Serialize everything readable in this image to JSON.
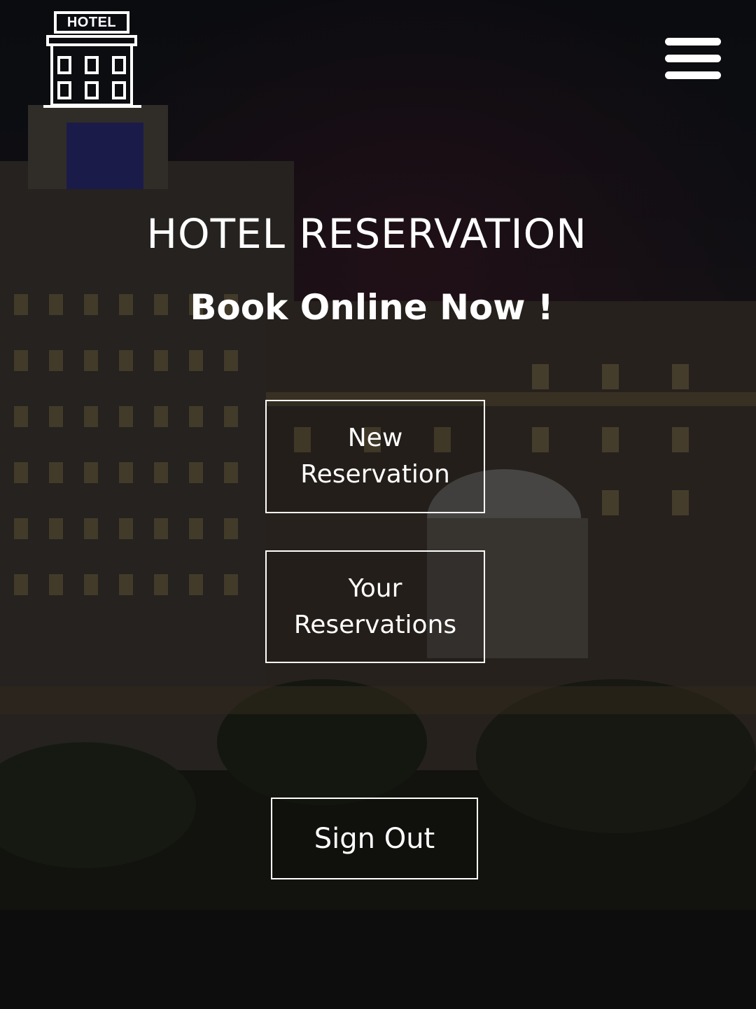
{
  "header": {
    "logo_text": "HOTEL",
    "logo_icon": "hotel-building-icon",
    "menu_icon": "hamburger-menu-icon"
  },
  "hero": {
    "title": "HOTEL RESERVATION",
    "subtitle": "Book Online Now !"
  },
  "actions": {
    "new_reservation_label": "New Reservation",
    "your_reservations_label": "Your Reservations",
    "sign_out_label": "Sign Out"
  },
  "colors": {
    "text": "#ffffff",
    "overlay": "#000000"
  }
}
